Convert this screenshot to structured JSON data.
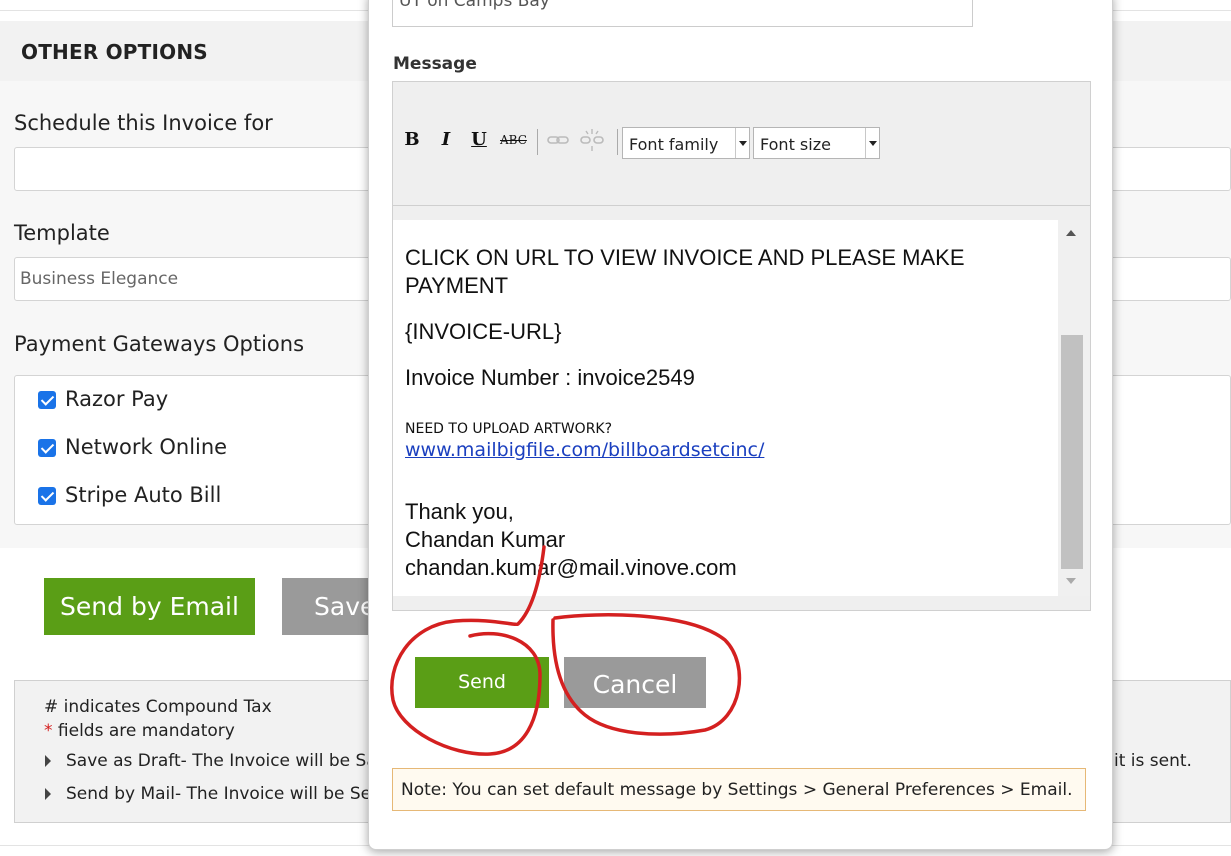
{
  "other_options": {
    "header": "OTHER OPTIONS",
    "schedule_label": "Schedule this Invoice for",
    "schedule_value": "",
    "template_label": "Template",
    "template_value": "Business Elegance",
    "gateways_label": "Payment Gateways Options",
    "gateways": [
      {
        "label": "Razor Pay",
        "checked": true
      },
      {
        "label": "Network Online",
        "checked": true
      },
      {
        "label": "Stripe Auto Bill",
        "checked": true
      }
    ]
  },
  "actions": {
    "send_by_email": "Send by Email",
    "save_partial": "Save"
  },
  "info": {
    "compound_tax": "# indicates Compound Tax",
    "mandatory_star": "*",
    "mandatory_text": " fields are mandatory",
    "save_draft": "Save as Draft- The Invoice will be Sa",
    "send_mail": "Send by Mail- The Invoice will be Se",
    "right_tail": "it is sent."
  },
  "modal": {
    "subject_value": "UT on Camps Bay",
    "message_label": "Message",
    "toolbar": {
      "bold": "B",
      "italic": "I",
      "underline": "U",
      "strike": "ABC",
      "font_family": "Font family",
      "font_size": "Font size"
    },
    "body": {
      "line1": "CLICK ON URL TO VIEW  INVOICE AND PLEASE MAKE",
      "line2": "PAYMENT",
      "invoice_url": "{INVOICE-URL}",
      "invoice_number": "Invoice Number : invoice2549",
      "upload_prompt": "NEED TO UPLOAD ARTWORK?",
      "upload_link": "www.mailbigfile.com/billboardsetcinc/",
      "thanks": "Thank you,",
      "name": "Chandan Kumar",
      "email": "chandan.kumar@mail.vinove.com"
    },
    "send_label": "Send",
    "cancel_label": "Cancel",
    "note": "Note: You can set default message by Settings > General Preferences > Email."
  },
  "colors": {
    "green": "#5a9e16",
    "gray_button": "#9a9a9a",
    "checkbox": "#1a73e8",
    "annotation": "#d42020",
    "link": "#1a3fbf"
  }
}
